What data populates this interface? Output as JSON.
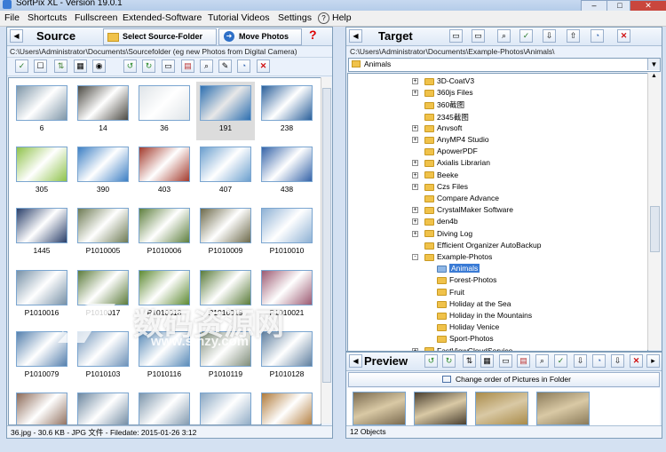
{
  "window": {
    "title": "SortPix XL - Version 19.0.1"
  },
  "menu": [
    "File",
    "Shortcuts",
    "Fullscreen",
    "Extended-Software",
    "Tutorial Videos",
    "Settings",
    "Help"
  ],
  "source": {
    "title": "Source",
    "select_btn": "Select Source-Folder",
    "move_btn": "Move Photos",
    "help_icon": "?",
    "path": "C:\\Users\\Administrator\\Documents\\Sourcefolder (eg new Photos from Digital Camera)",
    "thumbnails": [
      {
        "label": "6",
        "color": "#7e96a8"
      },
      {
        "label": "14",
        "color": "#4c4a43"
      },
      {
        "label": "36",
        "color": "#dfe4e8"
      },
      {
        "label": "191",
        "color": "#2d6fb0"
      },
      {
        "label": "238",
        "color": "#2a5f9a"
      },
      {
        "label": "305",
        "color": "#8fc24b"
      },
      {
        "label": "390",
        "color": "#3d7fc4"
      },
      {
        "label": "403",
        "color": "#a33a2c"
      },
      {
        "label": "407",
        "color": "#6b9fce"
      },
      {
        "label": "438",
        "color": "#3563a8"
      },
      {
        "label": "1445",
        "color": "#2a3f6a"
      },
      {
        "label": "P1010005",
        "color": "#6e7b54"
      },
      {
        "label": "P1010006",
        "color": "#5e7f3e"
      },
      {
        "label": "P1010009",
        "color": "#6d6a4b"
      },
      {
        "label": "P1010010",
        "color": "#8eb1d4"
      },
      {
        "label": "P1010016",
        "color": "#7791a7"
      },
      {
        "label": "P1010017",
        "color": "#5d7c3c"
      },
      {
        "label": "P1010018",
        "color": "#5e8a33"
      },
      {
        "label": "P1010019",
        "color": "#5a7b3a"
      },
      {
        "label": "P1010021",
        "color": "#9c5a72"
      },
      {
        "label": "P1010079",
        "color": "#5680ad"
      },
      {
        "label": "P1010103",
        "color": "#6e92b8"
      },
      {
        "label": "P1010116",
        "color": "#5a8bb8"
      },
      {
        "label": "P1010119",
        "color": "#7f8d7a"
      },
      {
        "label": "P1010128",
        "color": "#5f7f9f"
      },
      {
        "label": "",
        "color": "#8c6a58"
      },
      {
        "label": "",
        "color": "#6d87a0"
      },
      {
        "label": "",
        "color": "#7c95ab"
      },
      {
        "label": "",
        "color": "#8aa7c2"
      },
      {
        "label": "",
        "color": "#b07a3a"
      }
    ],
    "selected_index": 3,
    "status": "36.jpg - 30.6 KB - JPG 文件 - Filedate: 2015-01-26 3:12"
  },
  "target": {
    "title": "Target",
    "path": "C:\\Users\\Administrator\\Documents\\Example-Photos\\Animals\\",
    "dropdown_value": "Animals",
    "tree": [
      {
        "label": "3D-CoatV3",
        "level": 1,
        "expander": "+"
      },
      {
        "label": "360js Files",
        "level": 1,
        "expander": "+"
      },
      {
        "label": "360截图",
        "level": 1,
        "expander": ""
      },
      {
        "label": "2345截图",
        "level": 1,
        "expander": ""
      },
      {
        "label": "Anvsoft",
        "level": 1,
        "expander": "+"
      },
      {
        "label": "AnyMP4 Studio",
        "level": 1,
        "expander": "+"
      },
      {
        "label": "ApowerPDF",
        "level": 1,
        "expander": ""
      },
      {
        "label": "Axialis Librarian",
        "level": 1,
        "expander": "+"
      },
      {
        "label": "Beeke",
        "level": 1,
        "expander": "+"
      },
      {
        "label": "Czs Files",
        "level": 1,
        "expander": "+"
      },
      {
        "label": "Compare Advance",
        "level": 1,
        "expander": ""
      },
      {
        "label": "CrystalMaker Software",
        "level": 1,
        "expander": "+"
      },
      {
        "label": "den4b",
        "level": 1,
        "expander": "+"
      },
      {
        "label": "Diving Log",
        "level": 1,
        "expander": "+"
      },
      {
        "label": "Efficient Organizer AutoBackup",
        "level": 1,
        "expander": ""
      },
      {
        "label": "Example-Photos",
        "level": 1,
        "expander": "-"
      },
      {
        "label": "Animals",
        "level": 2,
        "expander": "",
        "selected": true
      },
      {
        "label": "Forest-Photos",
        "level": 2,
        "expander": ""
      },
      {
        "label": "Fruit",
        "level": 2,
        "expander": ""
      },
      {
        "label": "Holiday at the Sea",
        "level": 2,
        "expander": ""
      },
      {
        "label": "Holiday in the Mountains",
        "level": 2,
        "expander": ""
      },
      {
        "label": "Holiday Venice",
        "level": 2,
        "expander": ""
      },
      {
        "label": "Sport-Photos",
        "level": 2,
        "expander": ""
      },
      {
        "label": "FastViewCloudService",
        "level": 1,
        "expander": "+"
      }
    ]
  },
  "preview": {
    "title": "Preview",
    "change_order_btn": "Change order of Pictures in Folder",
    "thumbnails": [
      {
        "color": "#7a6a4f"
      },
      {
        "color": "#4a3f30"
      },
      {
        "color": "#a98b4a"
      },
      {
        "color": "#8b7b5a"
      }
    ],
    "status": "12 Objects"
  },
  "watermark": {
    "cn": "数码资源网",
    "url": "www.smzy.com"
  }
}
